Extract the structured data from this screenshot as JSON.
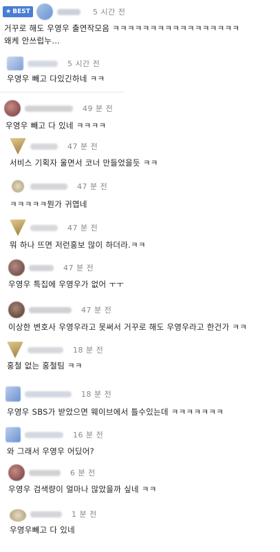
{
  "best_badge": {
    "star": "★",
    "label": "BEST"
  },
  "comments": [
    {
      "time": "5 시간 전",
      "lines": [
        "거꾸로 해도 우영우 출연작모음 ㅋㅋㅋㅋㅋㅋㅋㅋㅋㅋㅋㅋㅋㅋㅋㅋㅋ",
        "왜케 안쓰럽누..."
      ]
    },
    {
      "time": "5 시간 전",
      "lines": [
        "우영우 빼고 다있긴하네 ㅋㅋ"
      ]
    },
    {
      "time": "49 분 전",
      "lines": [
        "우영우 빼고 다 있네 ㅋㅋㅋㅋ"
      ]
    },
    {
      "time": "47 분 전",
      "lines": [
        "서비스 기획자 울면서 코너 만들었을듯 ㅋㅋ"
      ]
    },
    {
      "time": "47 분 전",
      "lines": [
        "ㅋㅋㅋㅋㅋ뭔가 귀엽네"
      ]
    },
    {
      "time": "47 분 전",
      "lines": [
        "뭐 하나 뜨면 저런홍보 많이 하더라.ㅋㅋ"
      ]
    },
    {
      "time": "47 분 전",
      "lines": [
        "우영우 특집에 우영우가 없어 ㅜㅜ"
      ]
    },
    {
      "time": "47 분 전",
      "lines": [
        "이상한 변호사 우영우라고 못써서 거꾸로 해도 우영우라고 한건가 ㅋㅋ"
      ]
    },
    {
      "time": "18 분 전",
      "lines": [
        "홍철 없는 홍철팀 ㅋㅋ"
      ]
    },
    {
      "time": "18 분 전",
      "lines": [
        "우영우 SBS가 받았으면 웨이브에서 틀수있는데 ㅋㅋㅋㅋㅋㅋㅋ"
      ]
    },
    {
      "time": "16 분 전",
      "lines": [
        "와 그래서 우영우 어딨어?"
      ]
    },
    {
      "time": "6 분 전",
      "lines": [
        "우영우 검색량이 얼마나 많았을까 싶네 ㅋㅋ"
      ]
    },
    {
      "time": "1 분 전",
      "lines": [
        "우영우빼고 다 있네"
      ]
    }
  ]
}
